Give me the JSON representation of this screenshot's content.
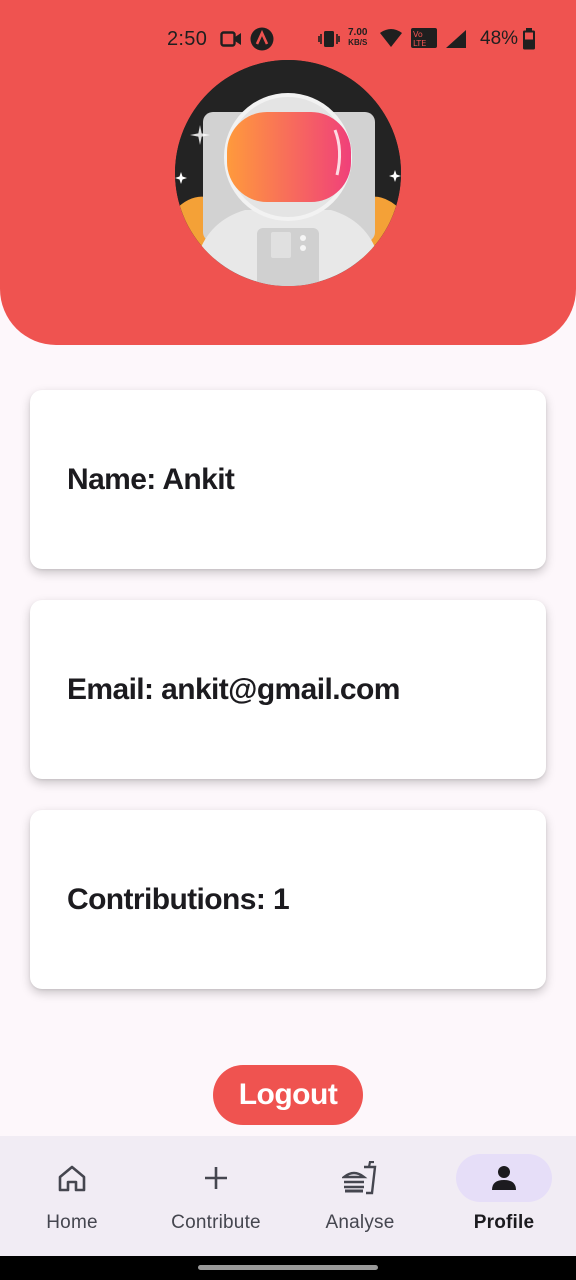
{
  "status_bar": {
    "time": "2:50",
    "net_speed_value": "7.00",
    "net_speed_unit": "KB/S",
    "battery_percent": "48%"
  },
  "profile": {
    "name_label": "Name: Ankit",
    "email_label": "Email: ankit@gmail.com",
    "contributions_label": "Contributions: 1"
  },
  "actions": {
    "logout_label": "Logout"
  },
  "bottom_nav": {
    "items": [
      {
        "label": "Home",
        "icon": "home-icon",
        "active": false
      },
      {
        "label": "Contribute",
        "icon": "plus-icon",
        "active": false
      },
      {
        "label": "Analyse",
        "icon": "fastfood-icon",
        "active": false
      },
      {
        "label": "Profile",
        "icon": "person-icon",
        "active": true
      }
    ]
  },
  "colors": {
    "accent": "#ef5350",
    "background": "#fdf7fb",
    "nav_background": "#f1ecf4",
    "active_pill": "#e6def8"
  }
}
